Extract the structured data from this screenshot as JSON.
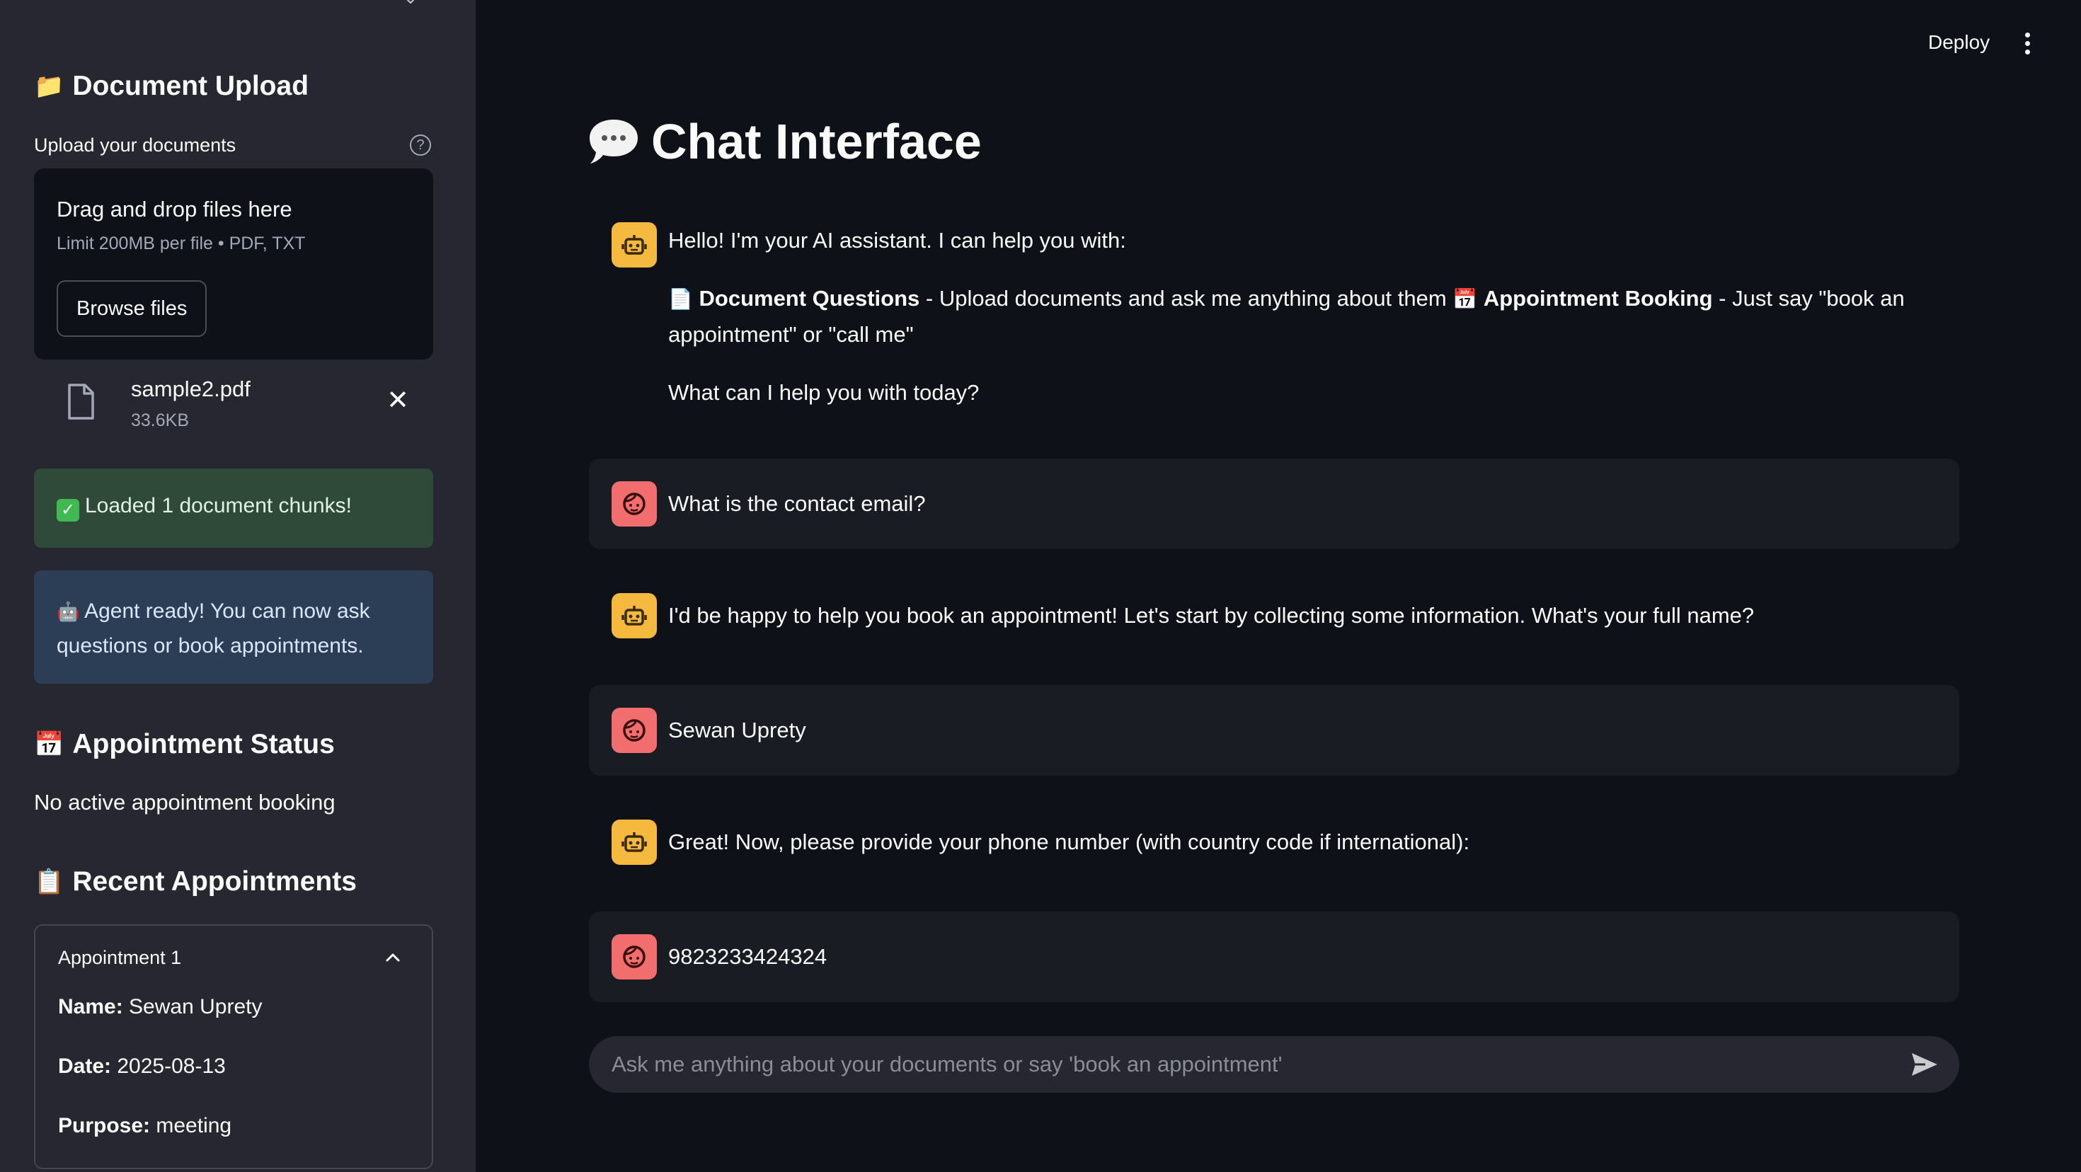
{
  "sidebar": {
    "collapse_icon": "chevron-icon",
    "upload_heading_emoji": "📁",
    "upload_heading": "Document Upload",
    "upload_label": "Upload your documents",
    "help_icon": "?",
    "dropzone_title": "Drag and drop files here",
    "dropzone_limit": "Limit 200MB per file • PDF, TXT",
    "browse_label": "Browse files",
    "file": {
      "name": "sample2.pdf",
      "size": "33.6KB"
    },
    "success_message": "Loaded 1 document chunks!",
    "info_emoji": "🤖",
    "info_message": "Agent ready! You can now ask questions or book appointments.",
    "status_heading_emoji": "📅",
    "status_heading": "Appointment Status",
    "status_text": "No active appointment booking",
    "recent_heading_emoji": "📋",
    "recent_heading": "Recent Appointments",
    "appointment": {
      "title": "Appointment 1",
      "name_label": "Name:",
      "name_value": "Sewan Uprety",
      "date_label": "Date:",
      "date_value": "2025-08-13",
      "purpose_label": "Purpose:",
      "purpose_value": "meeting"
    }
  },
  "header": {
    "deploy_label": "Deploy",
    "menu_icon": "kebab-menu-icon"
  },
  "main": {
    "title": "Chat Interface",
    "messages": [
      {
        "role": "assistant",
        "intro": "Hello! I'm your AI assistant. I can help you with:",
        "doc_emoji": "📄",
        "doc_bold": "Document Questions",
        "doc_text": " - Upload documents and ask me anything about them ",
        "appt_emoji": "📅",
        "appt_bold": "Appointment Booking",
        "appt_text": " - Just say \"book an appointment\" or \"call me\"",
        "closing": "What can I help you with today?"
      },
      {
        "role": "user",
        "text": "What is the contact email?"
      },
      {
        "role": "assistant",
        "text": "I'd be happy to help you book an appointment! Let's start by collecting some information. What's your full name?"
      },
      {
        "role": "user",
        "text": "Sewan Uprety"
      },
      {
        "role": "assistant",
        "text": "Great! Now, please provide your phone number (with country code if international):"
      },
      {
        "role": "user",
        "text": "9823233424324"
      }
    ],
    "input_placeholder": "Ask me anything about your documents or say 'book an appointment'"
  },
  "colors": {
    "background": "#0e1117",
    "sidebar": "#262730",
    "assistant_avatar": "#f5b940",
    "user_avatar": "#f26d6d",
    "success_bg": "#2f4a39",
    "info_bg": "#2c3e56"
  }
}
